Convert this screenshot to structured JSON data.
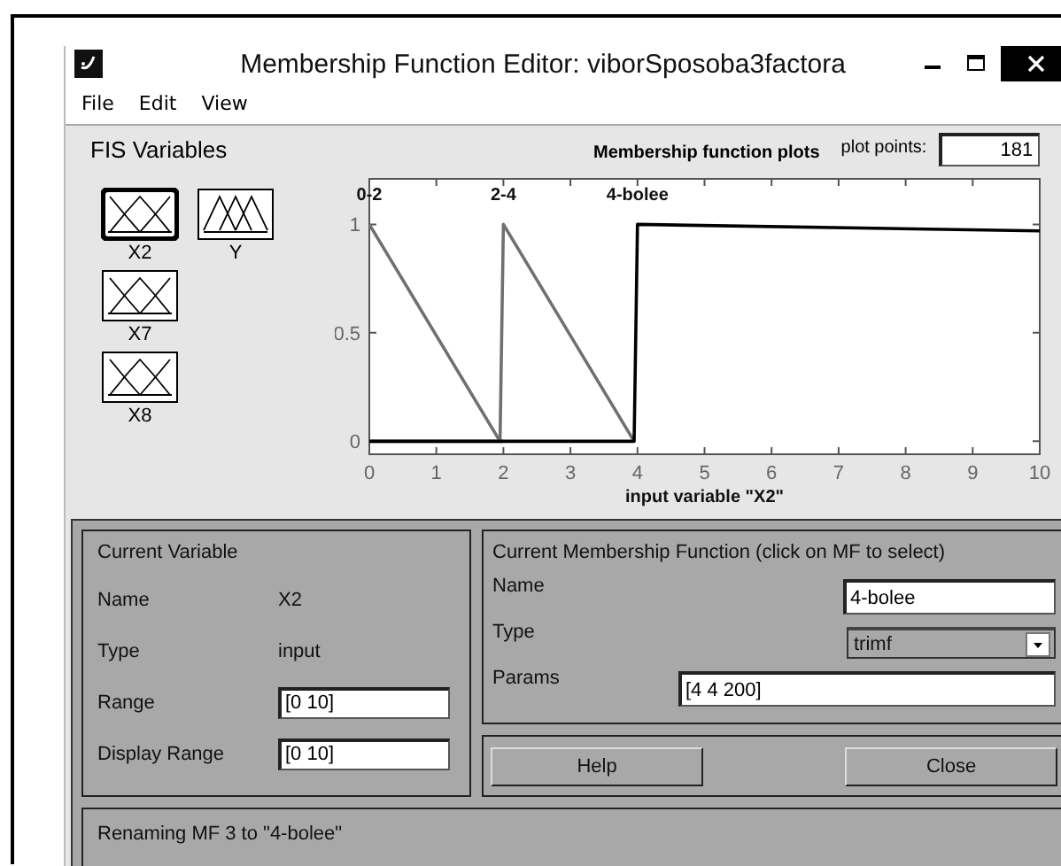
{
  "window": {
    "title": "Membership Function Editor: viborSposoba3factora"
  },
  "menu": [
    "File",
    "Edit",
    "View"
  ],
  "fis_variables": {
    "title": "FIS Variables",
    "items": [
      {
        "label": "X2",
        "kind": "input",
        "selected": true
      },
      {
        "label": "Y",
        "kind": "output",
        "selected": false
      },
      {
        "label": "X7",
        "kind": "input",
        "selected": false
      },
      {
        "label": "X8",
        "kind": "input",
        "selected": false
      }
    ]
  },
  "plot": {
    "title": "Membership function plots",
    "points_label": "plot points:",
    "points": "181",
    "chart_data": {
      "type": "line",
      "xlabel": "input variable \"X2\"",
      "x": [
        0,
        1.95,
        2,
        3.95,
        4,
        10
      ],
      "series": [
        {
          "name": "0-2",
          "color": "#707070",
          "values": [
            1,
            0,
            0,
            null,
            null,
            null
          ]
        },
        {
          "name": "2-4",
          "color": "#707070",
          "values": [
            0,
            0,
            1,
            0,
            null,
            null
          ]
        },
        {
          "name": "4-bolee",
          "color": "#000000",
          "values": [
            0,
            0,
            0,
            0,
            1,
            0.97
          ]
        }
      ],
      "xlim": [
        0,
        10
      ],
      "ylim": [
        -0.06,
        1.21
      ],
      "xticks": [
        0,
        1,
        2,
        3,
        4,
        5,
        6,
        7,
        8,
        9,
        10
      ],
      "yticks": [
        0,
        0.5,
        1
      ]
    }
  },
  "current_variable": {
    "title": "Current Variable",
    "fields": [
      {
        "label": "Name",
        "value": "X2",
        "kind": "text"
      },
      {
        "label": "Type",
        "value": "input",
        "kind": "text"
      },
      {
        "label": "Range",
        "value": "[0 10]",
        "kind": "input"
      },
      {
        "label": "Display Range",
        "value": "[0 10]",
        "kind": "input"
      }
    ]
  },
  "current_mf": {
    "title": "Current Membership Function (click on MF to select)",
    "name_label": "Name",
    "name": "4-bolee",
    "type_label": "Type",
    "type": "trimf",
    "params_label": "Params",
    "params": "[4 4 200]"
  },
  "buttons": [
    "Help",
    "Close"
  ],
  "status": "Renaming MF 3 to \"4-bolee\""
}
